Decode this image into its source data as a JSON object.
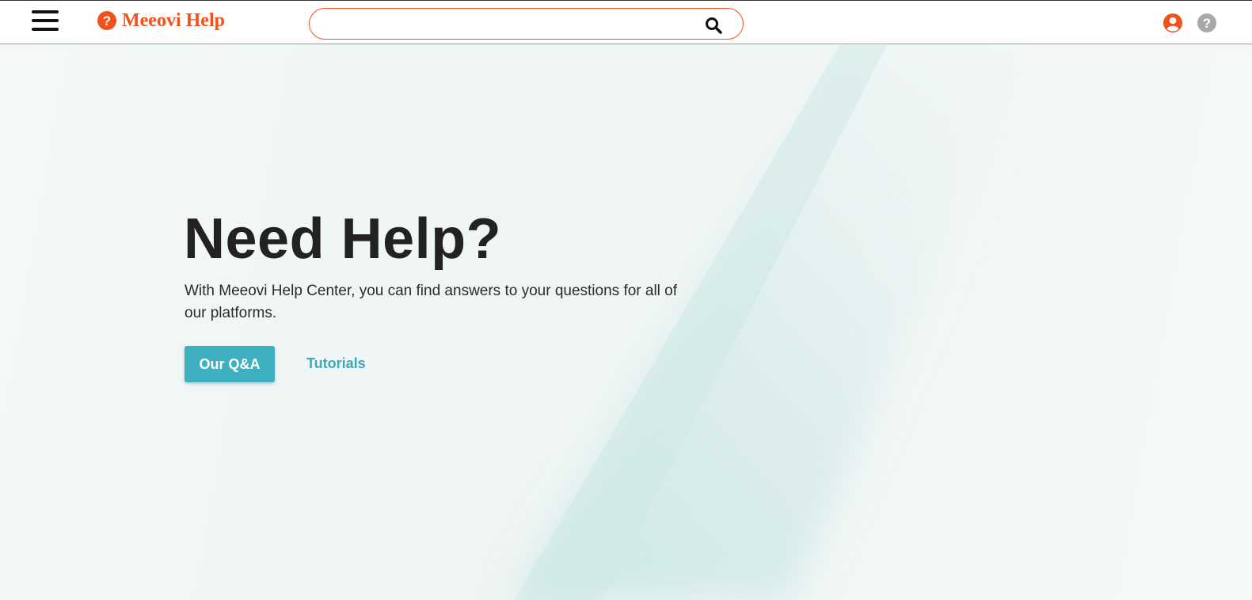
{
  "header": {
    "menu_icon": "hamburger-menu-icon",
    "logo": {
      "icon": "question-circle-icon",
      "text": "Meeovi Help"
    },
    "search": {
      "value": "",
      "placeholder": "",
      "icon": "search-icon"
    },
    "user_icon": "user-circle-icon",
    "help_icon": "question-circle-icon"
  },
  "hero": {
    "title": "Need Help?",
    "description": "With Meeovi Help Center, you can find answers to your questions for all of our platforms.",
    "primary_button": "Our Q&A",
    "secondary_link": "Tutorials"
  },
  "colors": {
    "brand": "#f2511b",
    "accent": "#3fb0bf",
    "help_icon": "#a9a9a9",
    "text": "#222222"
  }
}
